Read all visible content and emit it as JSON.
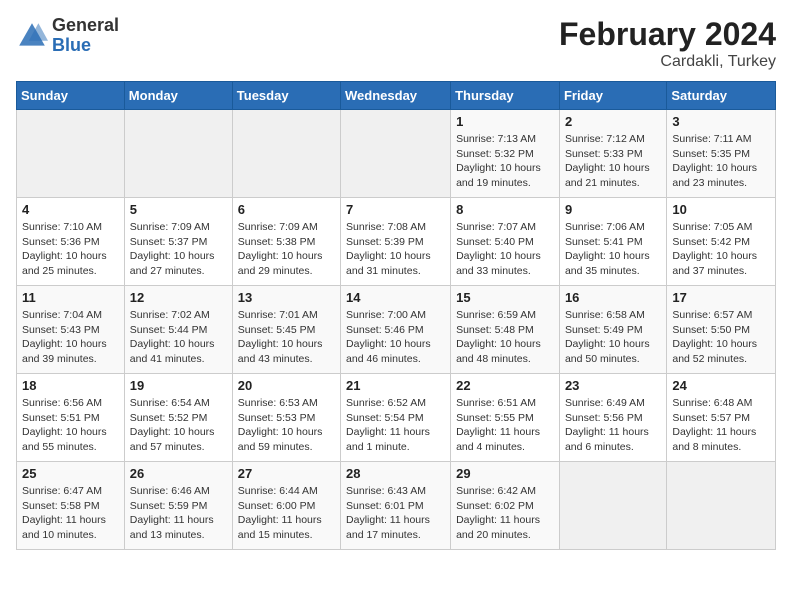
{
  "header": {
    "logo_general": "General",
    "logo_blue": "Blue",
    "month_year": "February 2024",
    "location": "Cardakli, Turkey"
  },
  "weekdays": [
    "Sunday",
    "Monday",
    "Tuesday",
    "Wednesday",
    "Thursday",
    "Friday",
    "Saturday"
  ],
  "weeks": [
    [
      {
        "day": "",
        "sunrise": "",
        "sunset": "",
        "daylight": ""
      },
      {
        "day": "",
        "sunrise": "",
        "sunset": "",
        "daylight": ""
      },
      {
        "day": "",
        "sunrise": "",
        "sunset": "",
        "daylight": ""
      },
      {
        "day": "",
        "sunrise": "",
        "sunset": "",
        "daylight": ""
      },
      {
        "day": "1",
        "sunrise": "Sunrise: 7:13 AM",
        "sunset": "Sunset: 5:32 PM",
        "daylight": "Daylight: 10 hours and 19 minutes."
      },
      {
        "day": "2",
        "sunrise": "Sunrise: 7:12 AM",
        "sunset": "Sunset: 5:33 PM",
        "daylight": "Daylight: 10 hours and 21 minutes."
      },
      {
        "day": "3",
        "sunrise": "Sunrise: 7:11 AM",
        "sunset": "Sunset: 5:35 PM",
        "daylight": "Daylight: 10 hours and 23 minutes."
      }
    ],
    [
      {
        "day": "4",
        "sunrise": "Sunrise: 7:10 AM",
        "sunset": "Sunset: 5:36 PM",
        "daylight": "Daylight: 10 hours and 25 minutes."
      },
      {
        "day": "5",
        "sunrise": "Sunrise: 7:09 AM",
        "sunset": "Sunset: 5:37 PM",
        "daylight": "Daylight: 10 hours and 27 minutes."
      },
      {
        "day": "6",
        "sunrise": "Sunrise: 7:09 AM",
        "sunset": "Sunset: 5:38 PM",
        "daylight": "Daylight: 10 hours and 29 minutes."
      },
      {
        "day": "7",
        "sunrise": "Sunrise: 7:08 AM",
        "sunset": "Sunset: 5:39 PM",
        "daylight": "Daylight: 10 hours and 31 minutes."
      },
      {
        "day": "8",
        "sunrise": "Sunrise: 7:07 AM",
        "sunset": "Sunset: 5:40 PM",
        "daylight": "Daylight: 10 hours and 33 minutes."
      },
      {
        "day": "9",
        "sunrise": "Sunrise: 7:06 AM",
        "sunset": "Sunset: 5:41 PM",
        "daylight": "Daylight: 10 hours and 35 minutes."
      },
      {
        "day": "10",
        "sunrise": "Sunrise: 7:05 AM",
        "sunset": "Sunset: 5:42 PM",
        "daylight": "Daylight: 10 hours and 37 minutes."
      }
    ],
    [
      {
        "day": "11",
        "sunrise": "Sunrise: 7:04 AM",
        "sunset": "Sunset: 5:43 PM",
        "daylight": "Daylight: 10 hours and 39 minutes."
      },
      {
        "day": "12",
        "sunrise": "Sunrise: 7:02 AM",
        "sunset": "Sunset: 5:44 PM",
        "daylight": "Daylight: 10 hours and 41 minutes."
      },
      {
        "day": "13",
        "sunrise": "Sunrise: 7:01 AM",
        "sunset": "Sunset: 5:45 PM",
        "daylight": "Daylight: 10 hours and 43 minutes."
      },
      {
        "day": "14",
        "sunrise": "Sunrise: 7:00 AM",
        "sunset": "Sunset: 5:46 PM",
        "daylight": "Daylight: 10 hours and 46 minutes."
      },
      {
        "day": "15",
        "sunrise": "Sunrise: 6:59 AM",
        "sunset": "Sunset: 5:48 PM",
        "daylight": "Daylight: 10 hours and 48 minutes."
      },
      {
        "day": "16",
        "sunrise": "Sunrise: 6:58 AM",
        "sunset": "Sunset: 5:49 PM",
        "daylight": "Daylight: 10 hours and 50 minutes."
      },
      {
        "day": "17",
        "sunrise": "Sunrise: 6:57 AM",
        "sunset": "Sunset: 5:50 PM",
        "daylight": "Daylight: 10 hours and 52 minutes."
      }
    ],
    [
      {
        "day": "18",
        "sunrise": "Sunrise: 6:56 AM",
        "sunset": "Sunset: 5:51 PM",
        "daylight": "Daylight: 10 hours and 55 minutes."
      },
      {
        "day": "19",
        "sunrise": "Sunrise: 6:54 AM",
        "sunset": "Sunset: 5:52 PM",
        "daylight": "Daylight: 10 hours and 57 minutes."
      },
      {
        "day": "20",
        "sunrise": "Sunrise: 6:53 AM",
        "sunset": "Sunset: 5:53 PM",
        "daylight": "Daylight: 10 hours and 59 minutes."
      },
      {
        "day": "21",
        "sunrise": "Sunrise: 6:52 AM",
        "sunset": "Sunset: 5:54 PM",
        "daylight": "Daylight: 11 hours and 1 minute."
      },
      {
        "day": "22",
        "sunrise": "Sunrise: 6:51 AM",
        "sunset": "Sunset: 5:55 PM",
        "daylight": "Daylight: 11 hours and 4 minutes."
      },
      {
        "day": "23",
        "sunrise": "Sunrise: 6:49 AM",
        "sunset": "Sunset: 5:56 PM",
        "daylight": "Daylight: 11 hours and 6 minutes."
      },
      {
        "day": "24",
        "sunrise": "Sunrise: 6:48 AM",
        "sunset": "Sunset: 5:57 PM",
        "daylight": "Daylight: 11 hours and 8 minutes."
      }
    ],
    [
      {
        "day": "25",
        "sunrise": "Sunrise: 6:47 AM",
        "sunset": "Sunset: 5:58 PM",
        "daylight": "Daylight: 11 hours and 10 minutes."
      },
      {
        "day": "26",
        "sunrise": "Sunrise: 6:46 AM",
        "sunset": "Sunset: 5:59 PM",
        "daylight": "Daylight: 11 hours and 13 minutes."
      },
      {
        "day": "27",
        "sunrise": "Sunrise: 6:44 AM",
        "sunset": "Sunset: 6:00 PM",
        "daylight": "Daylight: 11 hours and 15 minutes."
      },
      {
        "day": "28",
        "sunrise": "Sunrise: 6:43 AM",
        "sunset": "Sunset: 6:01 PM",
        "daylight": "Daylight: 11 hours and 17 minutes."
      },
      {
        "day": "29",
        "sunrise": "Sunrise: 6:42 AM",
        "sunset": "Sunset: 6:02 PM",
        "daylight": "Daylight: 11 hours and 20 minutes."
      },
      {
        "day": "",
        "sunrise": "",
        "sunset": "",
        "daylight": ""
      },
      {
        "day": "",
        "sunrise": "",
        "sunset": "",
        "daylight": ""
      }
    ]
  ]
}
